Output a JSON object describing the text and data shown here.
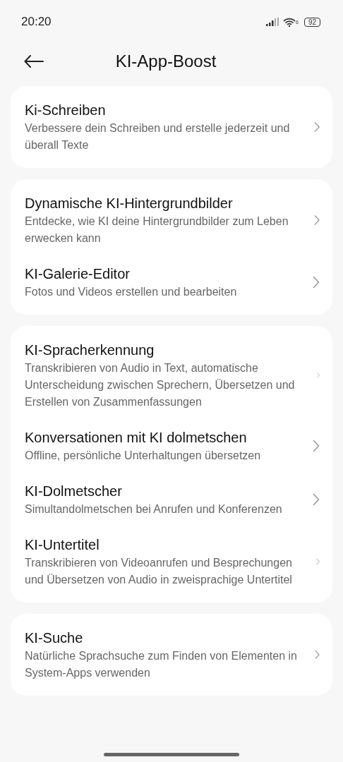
{
  "status_bar": {
    "time": "20:20",
    "wifi_label": "6",
    "battery": "92"
  },
  "header": {
    "title": "KI-App-Boost"
  },
  "groups": [
    {
      "items": [
        {
          "title": "Ki-Schreiben",
          "description": "Verbessere dein Schreiben und erstelle jederzeit und überall Texte"
        }
      ]
    },
    {
      "items": [
        {
          "title": "Dynamische KI-Hintergrundbilder",
          "description": "Entdecke, wie KI deine Hintergrundbilder zum Leben erwecken kann"
        },
        {
          "title": "KI-Galerie-Editor",
          "description": "Fotos und Videos erstellen und bearbeiten"
        }
      ]
    },
    {
      "items": [
        {
          "title": "KI-Spracherkennung",
          "description": "Transkribieren von Audio in Text, automatische Unterscheidung zwischen Sprechern, Übersetzen und Erstellen von Zusammenfassungen"
        },
        {
          "title": "Konversationen mit KI dolmetschen",
          "description": "Offline, persönliche Unterhaltungen übersetzen"
        },
        {
          "title": "KI-Dolmetscher",
          "description": "Simultandolmetschen bei Anrufen und Konferenzen"
        },
        {
          "title": "KI-Untertitel",
          "description": "Transkribieren von Videoanrufen und Besprechungen und Übersetzen von Audio in zweisprachige Untertitel"
        }
      ]
    },
    {
      "items": [
        {
          "title": "KI-Suche",
          "description": "Natürliche Sprachsuche zum Finden von Elementen in System-Apps verwenden"
        }
      ]
    }
  ]
}
